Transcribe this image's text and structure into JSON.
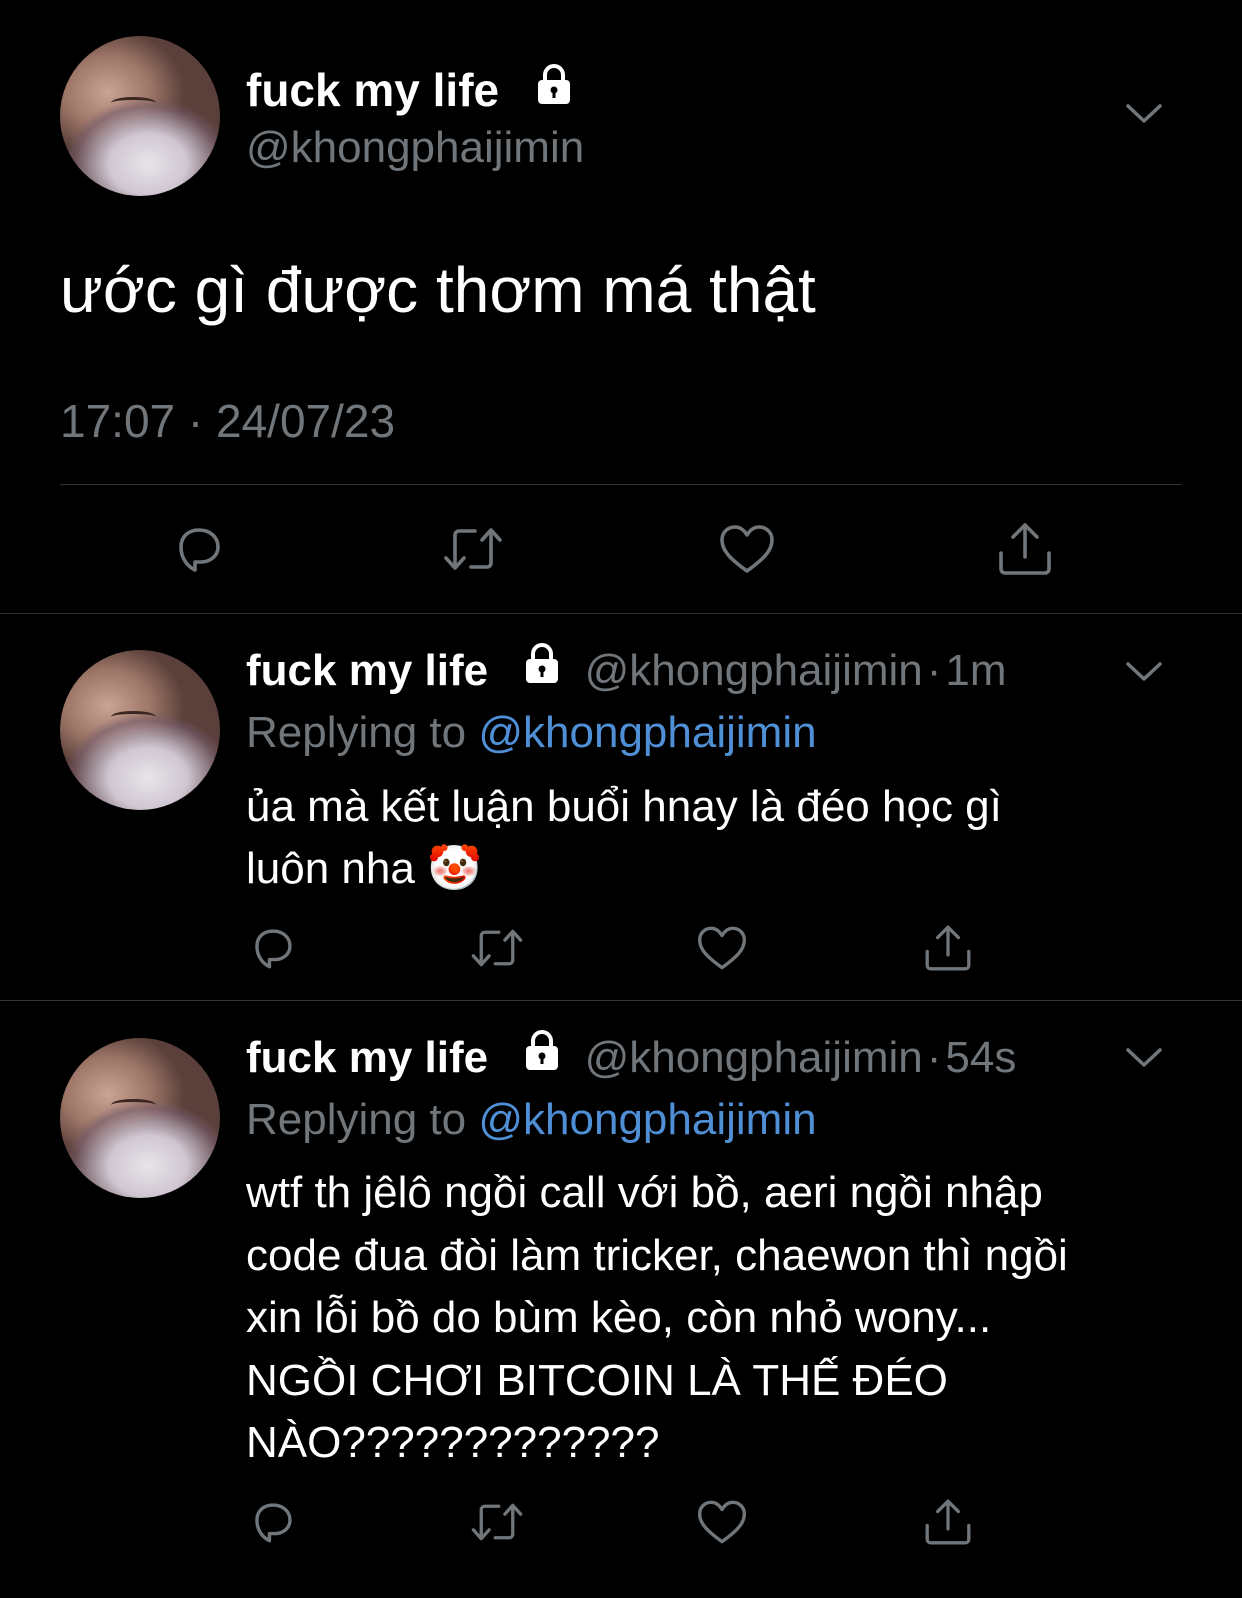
{
  "main_tweet": {
    "display_name": "fuck my life",
    "handle": "@khongphaijimin",
    "text": "ước gì được thơm má thật",
    "time": "17:07",
    "separator": "·",
    "date": "24/07/23"
  },
  "replies": [
    {
      "display_name": "fuck my life",
      "handle": "@khongphaijimin",
      "separator": "·",
      "time_ago": "1m",
      "replying_label": "Replying to",
      "replying_handle": "@khongphaijimin",
      "text": "ủa mà kết luận buổi hnay là đéo học gì\nluôn nha 🤡"
    },
    {
      "display_name": "fuck my life",
      "handle": "@khongphaijimin",
      "separator": "·",
      "time_ago": "54s",
      "replying_label": "Replying to",
      "replying_handle": "@khongphaijimin",
      "text": "wtf th jêlô ngồi call với bồ, aeri ngồi nhập\ncode đua đòi làm tricker, chaewon thì ngồi\nxin lỗi bồ do bùm kèo, còn nhỏ wony...\nNGỒI CHƠI BITCOIN LÀ THẾ ĐÉO\nNÀO?????????????"
    }
  ],
  "icons": {
    "reply": "reply-icon",
    "retweet": "retweet-icon",
    "like": "heart-icon",
    "share": "share-icon",
    "lock": "lock-icon",
    "more": "chevron-down-icon"
  },
  "colors": {
    "background": "#000000",
    "text": "#ffffff",
    "muted": "#71767b",
    "link": "#4f8fd6",
    "divider": "#2f3336"
  }
}
